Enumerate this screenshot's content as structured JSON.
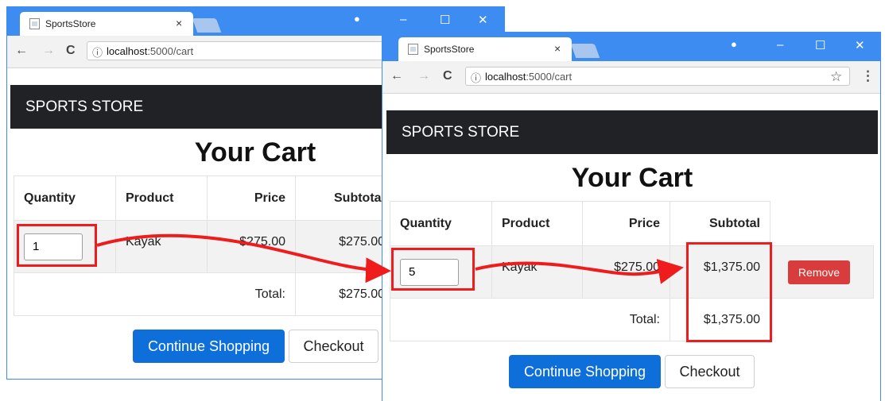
{
  "colors": {
    "titlebar": "#3c8cf2",
    "navbar": "#202225",
    "primary": "#0e6fdb",
    "danger": "#d93c3c",
    "highlight": "#ee1c1c"
  },
  "windows": [
    {
      "tab_title": "SportsStore",
      "tab_close": "×",
      "controls": {
        "account": "●",
        "minimize": "–",
        "maximize": "☐",
        "close": "✕"
      },
      "nav": {
        "back": "←",
        "forward": "→",
        "reload": "C",
        "info_icon": "ⓘ"
      },
      "url_host": "localhost",
      "url_path": ":5000/cart",
      "brand": "SPORTS STORE",
      "heading": "Your Cart",
      "columns": [
        "Quantity",
        "Product",
        "Price",
        "Subtotal"
      ],
      "item": {
        "quantity": "1",
        "product": "Kayak",
        "price": "$275.00",
        "subtotal": "$275.00"
      },
      "total_label": "Total:",
      "total_value": "$275.00",
      "continue_label": "Continue Shopping",
      "checkout_label": "Checkout"
    },
    {
      "tab_title": "SportsStore",
      "tab_close": "×",
      "controls": {
        "account": "●",
        "minimize": "–",
        "maximize": "☐",
        "close": "✕"
      },
      "nav": {
        "back": "←",
        "forward": "→",
        "reload": "C",
        "info_icon": "ⓘ",
        "star": "☆",
        "menu": "⋮"
      },
      "url_host": "localhost",
      "url_path": ":5000/cart",
      "brand": "SPORTS STORE",
      "heading": "Your Cart",
      "columns": [
        "Quantity",
        "Product",
        "Price",
        "Subtotal"
      ],
      "item": {
        "quantity": "5",
        "product": "Kayak",
        "price": "$275.00",
        "subtotal": "$1,375.00",
        "remove_label": "Remove"
      },
      "total_label": "Total:",
      "total_value": "$1,375.00",
      "continue_label": "Continue Shopping",
      "checkout_label": "Checkout"
    }
  ]
}
